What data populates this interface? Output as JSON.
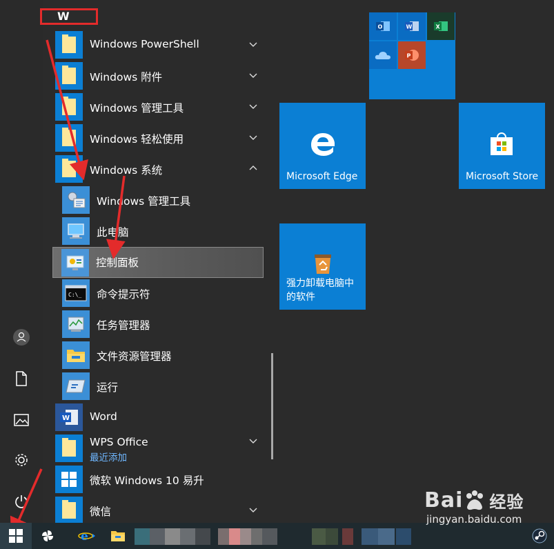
{
  "start_menu": {
    "letter_header": "W",
    "apps": [
      {
        "label": "Windows PowerShell",
        "expanded": false
      },
      {
        "label": "Windows 附件",
        "expanded": false
      },
      {
        "label": "Windows 管理工具",
        "expanded": false
      },
      {
        "label": "Windows 轻松使用",
        "expanded": false
      },
      {
        "label": "Windows 系统",
        "expanded": true
      }
    ],
    "system_items": [
      {
        "label": "Windows 管理工具"
      },
      {
        "label": "此电脑"
      },
      {
        "label": "控制面板",
        "selected": true
      },
      {
        "label": "命令提示符"
      },
      {
        "label": "任务管理器"
      },
      {
        "label": "文件资源管理器"
      },
      {
        "label": "运行"
      }
    ],
    "more_apps": {
      "word": "Word",
      "wps": "WPS Office",
      "wps_sub": "最近添加",
      "upgrade": "微软 Windows 10 易升",
      "wechat": "微信"
    }
  },
  "tiles": {
    "edge": "Microsoft Edge",
    "store": "Microsoft Store",
    "uninstall_line1": "强力卸载电脑中",
    "uninstall_line2": "的软件",
    "office_group": {
      "outlook": "O",
      "word": "W",
      "excel": "X",
      "powerpoint": "P"
    }
  },
  "watermark": {
    "brand": "Bai",
    "brand_cn": "经验",
    "url": "jingyan.baidu.com"
  },
  "colors": {
    "tile_blue": "#0b7fd4",
    "highlight_red": "#e32b2b",
    "folder_yellow": "#fde79a"
  }
}
